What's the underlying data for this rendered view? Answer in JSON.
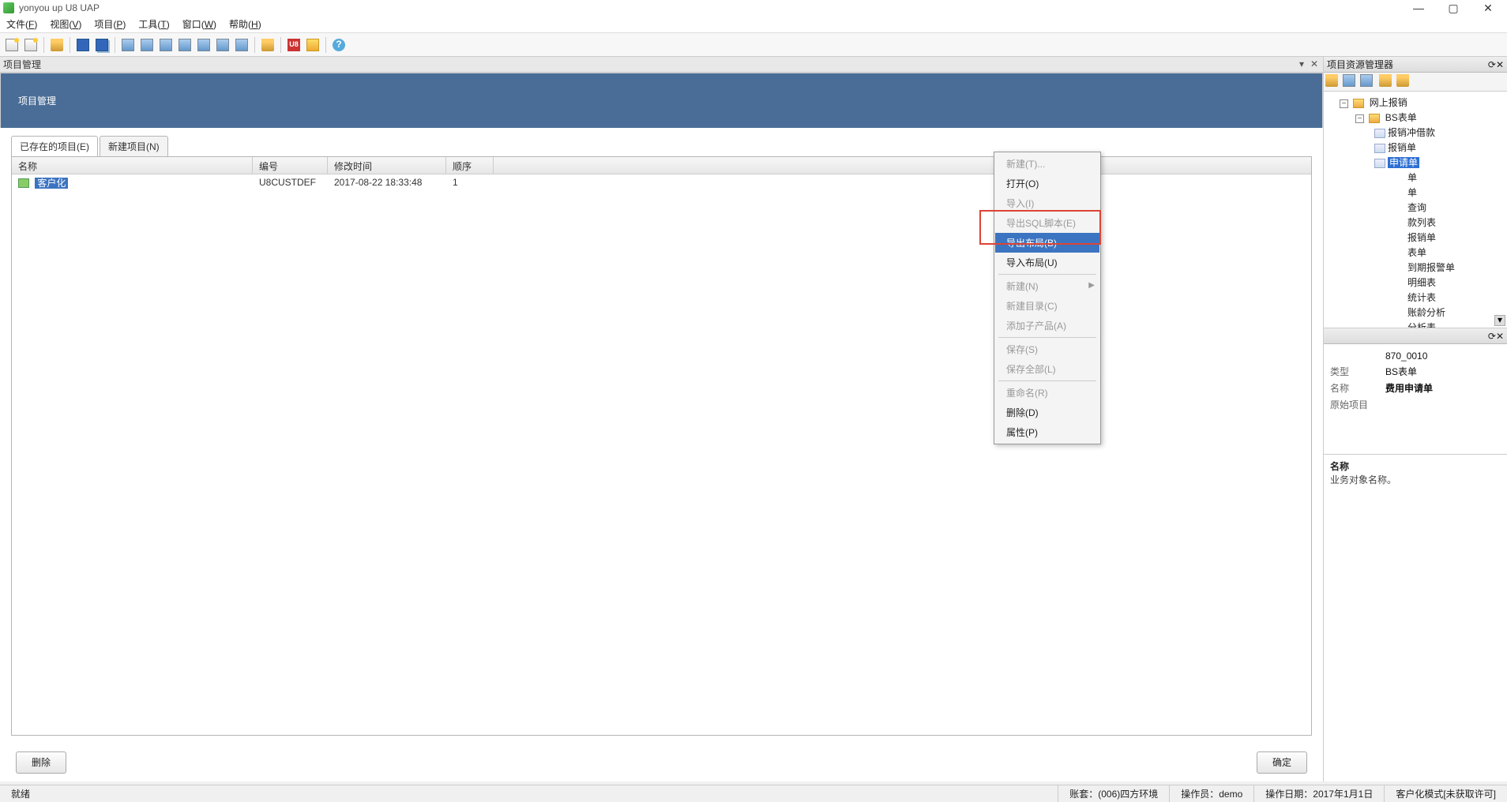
{
  "app": {
    "title": "yonyou up U8 UAP"
  },
  "window_buttons": {
    "min": "—",
    "max": "▢",
    "close": "✕"
  },
  "menubar": [
    {
      "label": "文件(",
      "key": "F",
      "tail": ")"
    },
    {
      "label": "视图(",
      "key": "V",
      "tail": ")"
    },
    {
      "label": "项目(",
      "key": "P",
      "tail": ")"
    },
    {
      "label": "工具(",
      "key": "T",
      "tail": ")"
    },
    {
      "label": "窗口(",
      "key": "W",
      "tail": ")"
    },
    {
      "label": "帮助(",
      "key": "H",
      "tail": ")"
    }
  ],
  "left_pane": {
    "title": "项目管理",
    "banner": "项目管理",
    "tabs": {
      "existing": "已存在的项目(E)",
      "new": "新建项目(N)"
    },
    "grid": {
      "headers": {
        "name": "名称",
        "code": "编号",
        "mtime": "修改时间",
        "order": "顺序"
      },
      "rows": [
        {
          "name": "客户化",
          "code": "U8CUSTDEF",
          "mtime": "2017-08-22 18:33:48",
          "order": "1"
        }
      ]
    },
    "buttons": {
      "delete": "删除",
      "ok": "确定"
    }
  },
  "right_pane": {
    "title": "项目资源管理器",
    "tree": {
      "root": "网上报销",
      "folder": "BS表单",
      "items": [
        "报销冲借款",
        "报销单",
        "申请单",
        "单",
        "单",
        "查询",
        "款列表",
        "报销单",
        "表单",
        "到期报警单",
        "明细表",
        "统计表",
        "账龄分析",
        "分析表"
      ],
      "selected_suffix": "申请单"
    },
    "props_title": "",
    "props": [
      {
        "k": "",
        "v": "870_0010"
      },
      {
        "k": "类型",
        "v": "BS表单"
      },
      {
        "k": "名称",
        "v": "费用申请单",
        "bold": true
      },
      {
        "k": "原始项目",
        "v": ""
      }
    ],
    "desc": {
      "k": "名称",
      "v": "业务对象名称。"
    }
  },
  "context_menu": {
    "items": [
      {
        "label": "新建(T)...",
        "disabled": true
      },
      {
        "label": "打开(O)"
      },
      {
        "label": "导入(I)",
        "disabled": true
      },
      {
        "label": "导出SQL脚本(E)",
        "disabled": true
      },
      {
        "label": "导出布局(B)",
        "hover": true
      },
      {
        "label": "导入布局(U)"
      },
      {
        "sep": true
      },
      {
        "label": "新建(N)",
        "disabled": true,
        "submenu": true
      },
      {
        "label": "新建目录(C)",
        "disabled": true
      },
      {
        "label": "添加子产品(A)",
        "disabled": true
      },
      {
        "sep": true
      },
      {
        "label": "保存(S)",
        "disabled": true
      },
      {
        "label": "保存全部(L)",
        "disabled": true
      },
      {
        "sep": true
      },
      {
        "label": "重命名(R)",
        "disabled": true
      },
      {
        "label": "删除(D)"
      },
      {
        "label": "属性(P)"
      }
    ]
  },
  "statusbar": {
    "ready": "就绪",
    "account": "账套：(006)四方环境",
    "operator": "操作员：demo",
    "opdate": "操作日期：2017年1月1日",
    "mode": "客户化模式[未获取许可]"
  },
  "icons": {
    "u8": "U8",
    "help": "?"
  }
}
